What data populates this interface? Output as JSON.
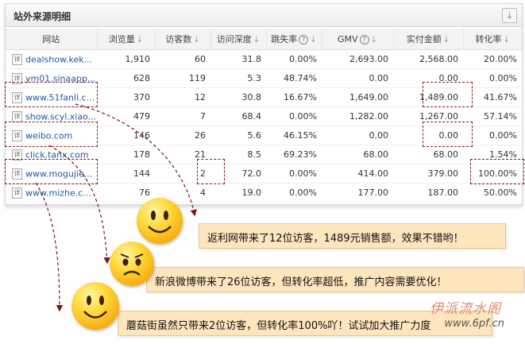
{
  "panel": {
    "title": "站外来源明细",
    "download_icon": "download-icon"
  },
  "table": {
    "headers": [
      "网站",
      "浏览量",
      "访客数",
      "访问深度",
      "跳失率",
      "GMV",
      "实付金额",
      "转化率"
    ],
    "detail_label": "详",
    "rows": [
      [
        "dealshow.kek...",
        "1,910",
        "60",
        "31.8",
        "0.00%",
        "2,693.00",
        "2,568.00",
        "20.00%"
      ],
      [
        "ym01.sinaapp...",
        "628",
        "119",
        "5.3",
        "48.74%",
        "0.00",
        "0.00",
        "0.00%"
      ],
      [
        "www.51fanli.c...",
        "370",
        "12",
        "30.8",
        "16.67%",
        "1,649.00",
        "1,489.00",
        "41.67%"
      ],
      [
        "show.scyl.xiao...",
        "479",
        "7",
        "68.4",
        "0.00%",
        "1,282.00",
        "1,267.00",
        "57.14%"
      ],
      [
        "weibo.com",
        "146",
        "26",
        "5.6",
        "46.15%",
        "0.00",
        "0.00",
        "0.00%"
      ],
      [
        "click.tanx.com",
        "178",
        "21",
        "8.5",
        "69.23%",
        "68.00",
        "68.00",
        "1.54%"
      ],
      [
        "www.mogujie...",
        "144",
        "2",
        "72.0",
        "0.00%",
        "414.00",
        "379.00",
        "100.00%"
      ],
      [
        "www.mizhe.c...",
        "76",
        "4",
        "19.0",
        "0.00%",
        "177.00",
        "187.00",
        "50.00%"
      ]
    ]
  },
  "callouts": [
    "返利网带来了12位访客，1489元销售额，效果不错哟！",
    "新浪微博带来了26位访客，但转化率超低，推广内容需要优化！",
    "蘑菇街虽然只带来2位访客，但转化率100%吖！试试加大推广力度"
  ],
  "watermark": {
    "text": "伊派流水阁",
    "url": "www.6pf.cn"
  },
  "colors": {
    "highlight": "#8a1c1c",
    "callout_bg": "#fde5bd",
    "link": "#2257a6"
  }
}
